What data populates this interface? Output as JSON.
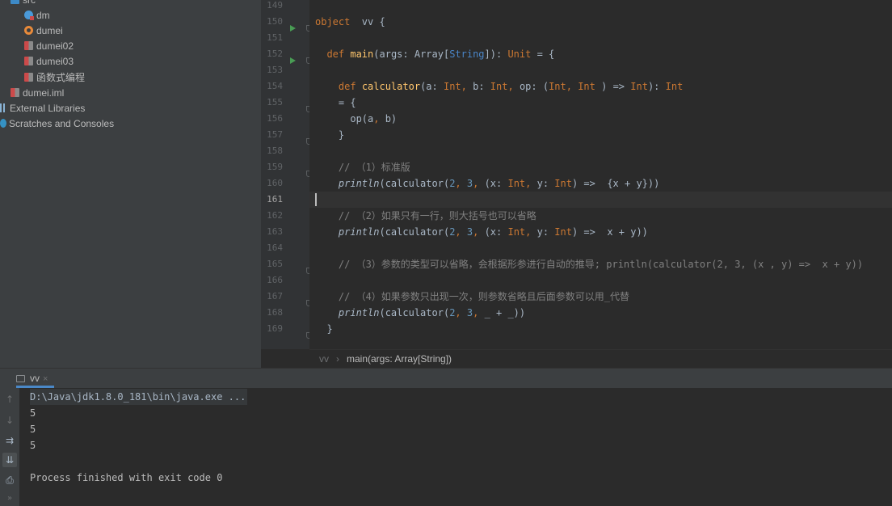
{
  "project": {
    "items": [
      {
        "label": "src",
        "icon": "folder-icon"
      },
      {
        "label": "dm",
        "icon": "scala-object-icon"
      },
      {
        "label": "dumei",
        "icon": "object-icon"
      },
      {
        "label": "dumei02",
        "icon": "scala-file-icon"
      },
      {
        "label": "dumei03",
        "icon": "scala-file-icon"
      },
      {
        "label": "函数式编程",
        "icon": "scala-file-icon"
      },
      {
        "label": "dumei.iml",
        "icon": "module-file-icon"
      },
      {
        "label": "External Libraries",
        "icon": "library-icon"
      },
      {
        "label": "Scratches and Consoles",
        "icon": "scratch-icon"
      }
    ]
  },
  "editor": {
    "line_numbers": [
      "149",
      "150",
      "151",
      "152",
      "153",
      "154",
      "155",
      "156",
      "157",
      "158",
      "159",
      "160",
      "161",
      "162",
      "163",
      "164",
      "165",
      "166",
      "167",
      "168",
      "169"
    ],
    "current_line": "161",
    "lines": [
      {
        "text": ""
      },
      {
        "parts": [
          [
            "kw",
            "object"
          ],
          [
            "",
            "  vv {"
          ]
        ]
      },
      {
        "text": ""
      },
      {
        "parts": [
          [
            "",
            "  "
          ],
          [
            "kw",
            "def "
          ],
          [
            "fn",
            "main"
          ],
          [
            "",
            "(args: Array["
          ],
          [
            "tp",
            "String"
          ],
          [
            "",
            "]): "
          ],
          [
            "kw",
            "Unit"
          ],
          [
            "",
            " = {"
          ]
        ]
      },
      {
        "text": ""
      },
      {
        "parts": [
          [
            "",
            "    "
          ],
          [
            "kw",
            "def "
          ],
          [
            "fn",
            "calculator"
          ],
          [
            "",
            "(a: "
          ],
          [
            "kw",
            "Int"
          ],
          [
            "kw",
            ", "
          ],
          [
            "",
            "b: "
          ],
          [
            "kw",
            "Int"
          ],
          [
            "kw",
            ", "
          ],
          [
            "",
            "op: ("
          ],
          [
            "kw",
            "Int"
          ],
          [
            "kw",
            ", "
          ],
          [
            "kw",
            "Int"
          ],
          [
            "",
            " ) => "
          ],
          [
            "kw",
            "Int"
          ],
          [
            "",
            "): "
          ],
          [
            "kw",
            "Int"
          ]
        ]
      },
      {
        "text": "    = {"
      },
      {
        "parts": [
          [
            "",
            "      op(a"
          ],
          [
            "kw",
            ", "
          ],
          [
            "",
            "b)"
          ]
        ]
      },
      {
        "text": "    }"
      },
      {
        "text": ""
      },
      {
        "parts": [
          [
            "cm",
            "    // （1）标准版"
          ]
        ]
      },
      {
        "parts": [
          [
            "it",
            "    println"
          ],
          [
            "",
            "(calculator("
          ],
          [
            "num",
            "2"
          ],
          [
            "kw",
            ", "
          ],
          [
            "num",
            "3"
          ],
          [
            "kw",
            ", "
          ],
          [
            "",
            "(x: "
          ],
          [
            "kw",
            "Int"
          ],
          [
            "kw",
            ", "
          ],
          [
            "",
            "y: "
          ],
          [
            "kw",
            "Int"
          ],
          [
            "",
            ") =>  {x + y}))"
          ]
        ]
      },
      {
        "text": ""
      },
      {
        "parts": [
          [
            "cm",
            "    // （2）如果只有一行，则大括号也可以省略"
          ]
        ]
      },
      {
        "parts": [
          [
            "it",
            "    println"
          ],
          [
            "",
            "(calculator("
          ],
          [
            "num",
            "2"
          ],
          [
            "kw",
            ", "
          ],
          [
            "num",
            "3"
          ],
          [
            "kw",
            ", "
          ],
          [
            "",
            "(x: "
          ],
          [
            "kw",
            "Int"
          ],
          [
            "kw",
            ", "
          ],
          [
            "",
            "y: "
          ],
          [
            "kw",
            "Int"
          ],
          [
            "",
            ") =>  x + y))"
          ]
        ]
      },
      {
        "text": ""
      },
      {
        "parts": [
          [
            "cm",
            "    // （3）参数的类型可以省略，会根据形参进行自动的推导; println(calculator(2, 3, (x , y) =>  x + y))"
          ]
        ]
      },
      {
        "text": ""
      },
      {
        "parts": [
          [
            "cm",
            "    // （4）如果参数只出现一次，则参数省略且后面参数可以用_代替"
          ]
        ]
      },
      {
        "parts": [
          [
            "it",
            "    println"
          ],
          [
            "",
            "(calculator("
          ],
          [
            "num",
            "2"
          ],
          [
            "kw",
            ", "
          ],
          [
            "num",
            "3"
          ],
          [
            "kw",
            ", "
          ],
          [
            "",
            "_ + _))"
          ]
        ]
      },
      {
        "text": "  }"
      }
    ]
  },
  "breadcrumb": {
    "object": "vv",
    "method": "main(args: Array[String])"
  },
  "run": {
    "tab_label": "vv",
    "tab_close": "×",
    "output": [
      "D:\\Java\\jdk1.8.0_181\\bin\\java.exe ...",
      "5",
      "5",
      "5",
      "",
      "Process finished with exit code 0"
    ],
    "toolbar": [
      "↑",
      "↓",
      "⇉",
      "⇊",
      "⎙",
      "»"
    ]
  },
  "colors": {
    "keyword": "#cc7832",
    "function": "#ffc66d",
    "number": "#6897bb",
    "comment": "#808080",
    "run_tab_underline": "#4a88c7"
  }
}
